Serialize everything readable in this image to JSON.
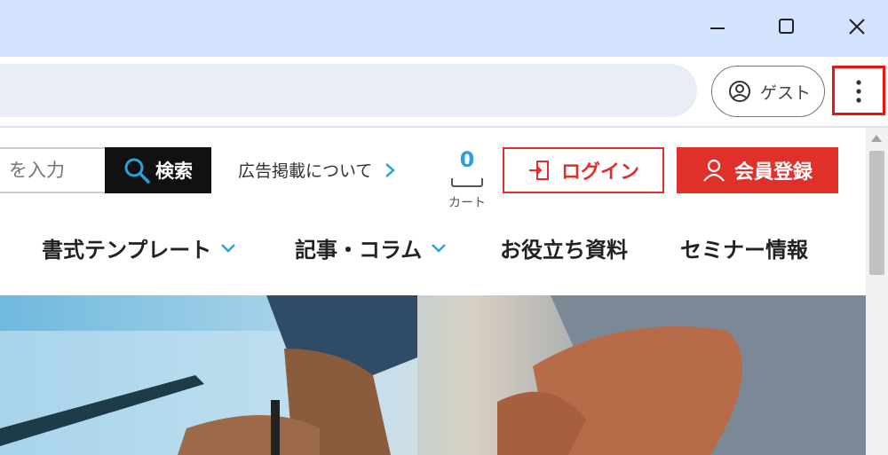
{
  "browser": {
    "window_controls": [
      "minimize-icon",
      "maximize-icon",
      "close-icon"
    ],
    "profile_label": "ゲスト",
    "menu_icon": "three-dots-vertical-icon"
  },
  "site": {
    "search": {
      "placeholder": "を入力",
      "button_label": "検索"
    },
    "ad_link": "広告掲載について",
    "cart": {
      "count": "0",
      "label": "カート"
    },
    "login_label": "ログイン",
    "register_label": "会員登録",
    "nav": [
      {
        "label": "書式テンプレート",
        "has_dropdown": true
      },
      {
        "label": "記事・コラム",
        "has_dropdown": true
      },
      {
        "label": "お役立ち資料",
        "has_dropdown": false
      },
      {
        "label": "セミナー情報",
        "has_dropdown": false
      }
    ],
    "colors": {
      "accent_red": "#e0302a",
      "accent_blue": "#2ba1d9",
      "titlebar": "#d3e3fd"
    }
  }
}
